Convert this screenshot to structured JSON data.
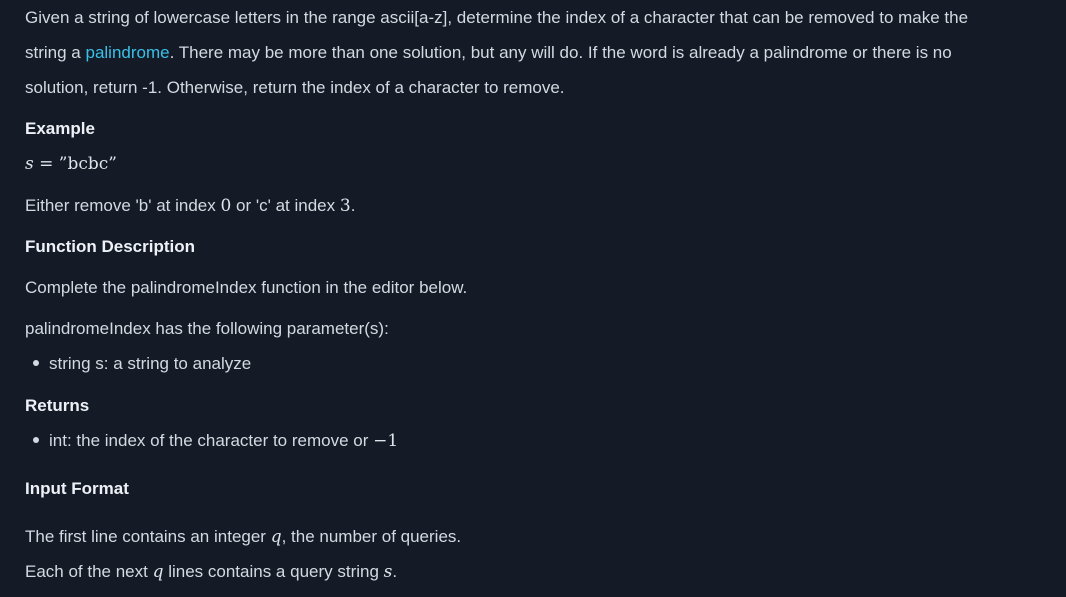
{
  "intro": {
    "line1": "Given a string of lowercase letters in the range ascii[a-z], determine the index of a character that can be removed to make the",
    "line2_pre": "string a ",
    "line2_link": "palindrome",
    "line2_post": ". There may be more than one solution, but any will do. If the word is already a palindrome or there is no",
    "line3": "solution, return -1. Otherwise, return the index of a character to remove."
  },
  "example": {
    "heading": "Example",
    "formula_var": "s",
    "formula_eq": " = ”bcbc”",
    "text_pre": "Either remove 'b' at index ",
    "index_b": "0",
    "text_mid": " or 'c' at index ",
    "index_c": "3",
    "text_post": "."
  },
  "function_description": {
    "heading": "Function Description",
    "line1": "Complete the palindromeIndex function in the editor below.",
    "line2": "palindromeIndex has the following parameter(s):",
    "param1": "string s: a string to analyze"
  },
  "returns": {
    "heading": "Returns",
    "item1_text": "int: the index of the character to remove or ",
    "item1_value": "−1"
  },
  "input_format": {
    "heading": "Input Format",
    "line1_pre": "The first line contains an integer ",
    "line1_var": "q",
    "line1_post": ", the number of queries.",
    "line2_pre": "Each of the next ",
    "line2_var": "q",
    "line2_mid": " lines contains a query string ",
    "line2_var2": "s",
    "line2_post": "."
  }
}
